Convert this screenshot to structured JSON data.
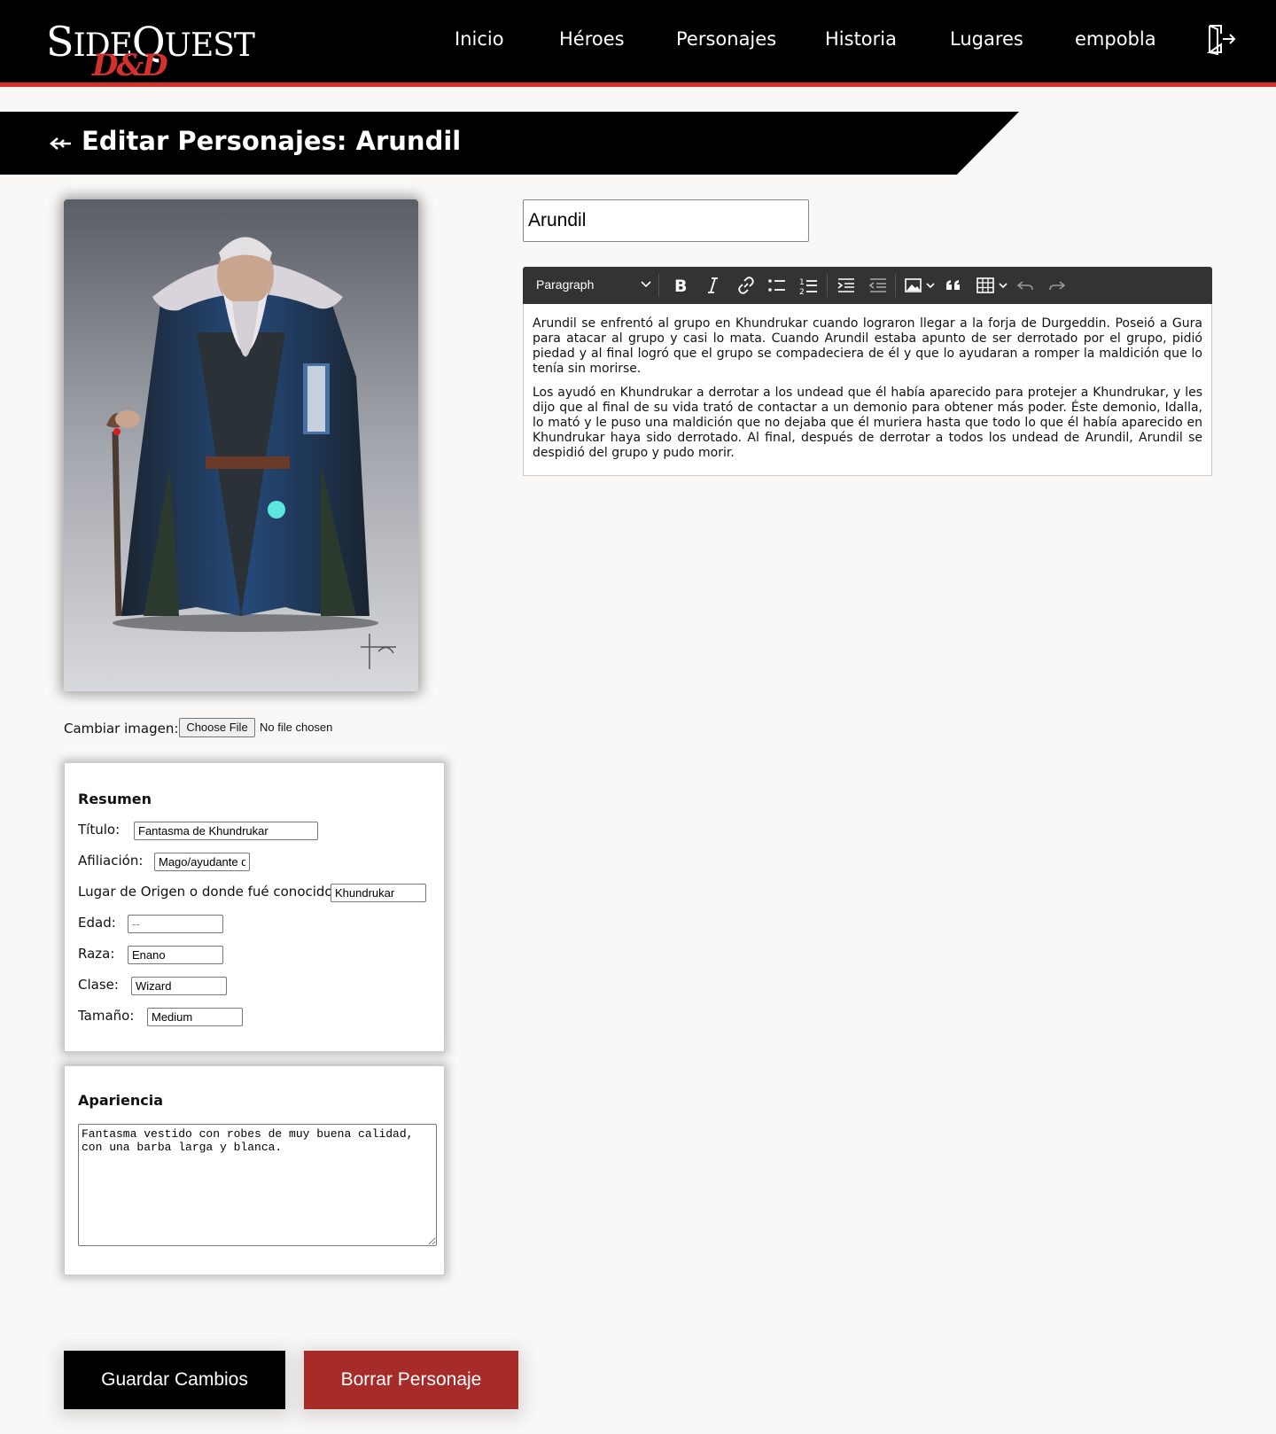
{
  "header": {
    "logo_top": "SideQuest",
    "logo_bottom": "D&D",
    "nav": [
      {
        "label": "Inicio"
      },
      {
        "label": "Héroes"
      },
      {
        "label": "Personajes"
      },
      {
        "label": "Historia"
      },
      {
        "label": "Lugares"
      },
      {
        "label": "empobla"
      }
    ],
    "logout_icon": "logout-door-icon"
  },
  "page": {
    "title": "Editar Personajes: Arundil",
    "back_icon": "back-arrow-icon"
  },
  "portrait": {
    "subject": "dwarf-wizard-portrait"
  },
  "file": {
    "label": "Cambiar imagen:",
    "button": "Choose File",
    "status": "No file chosen"
  },
  "resumen": {
    "title": "Resumen",
    "fields": [
      {
        "label": "Título:",
        "value": "Fantasma de Khundrukar",
        "placeholder": ""
      },
      {
        "label": "Afiliación:",
        "value": "Mago/ayudante de Durgeddin",
        "placeholder": ""
      },
      {
        "label": "Lugar de Origen o donde fué conocido:",
        "value": "Khundrukar",
        "placeholder": ""
      },
      {
        "label": "Edad:",
        "value": "",
        "placeholder": "--"
      },
      {
        "label": "Raza:",
        "value": "Enano",
        "placeholder": ""
      },
      {
        "label": "Clase:",
        "value": "Wizard",
        "placeholder": ""
      },
      {
        "label": "Tamaño:",
        "value": "Medium",
        "placeholder": ""
      }
    ]
  },
  "apariencia": {
    "title": "Apariencia",
    "value": "Fantasma vestido con robes de muy buena calidad, con una barba larga y blanca."
  },
  "character": {
    "name": "Arundil"
  },
  "editor": {
    "toolbar": {
      "paragraph": "Paragraph",
      "icons": [
        "bold-icon",
        "italic-icon",
        "link-icon",
        "bulleted-list-icon",
        "numbered-list-icon",
        "indent-icon",
        "outdent-icon",
        "image-icon",
        "blockquote-icon",
        "table-icon",
        "undo-icon",
        "redo-icon"
      ]
    },
    "paragraphs": [
      "Arundil se enfrentó al grupo en Khundrukar cuando lograron llegar a la forja de Durgeddin. Poseió a Gura para atacar al grupo y casi lo mata. Cuando Arundil estaba apunto de ser derrotado por el grupo, pidió piedad y al final logró que el grupo se compadeciera de él y que lo ayudaran a romper la maldición que lo tenía sin morirse.",
      "Los ayudó en Khundrukar a derrotar a los undead que él había aparecido para protejer a Khundrukar, y les dijo que al final de su vida trató de contactar a un demonio para obtener más poder. Éste demonio, Idalla, lo mató y le puso una maldición que no dejaba que él muriera hasta que todo lo que él había aparecido en Khundrukar haya sido derrotado. Al final, después de derrotar a todos los undead de Arundil, Arundil se despidió del grupo y pudo morir."
    ]
  },
  "actions": {
    "save": "Guardar Cambios",
    "delete": "Borrar Personaje"
  },
  "colors": {
    "accent_red": "#d4302c",
    "delete_button": "#a72b29",
    "header_bg": "#000000",
    "page_bg": "#f9f8f6"
  }
}
